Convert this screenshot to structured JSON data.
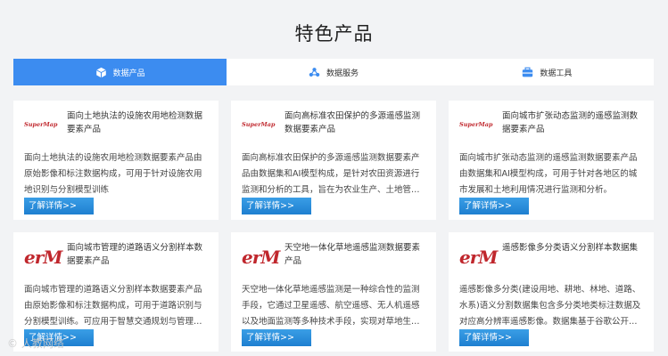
{
  "page_title": "特色产品",
  "tabs": [
    {
      "label": "数据产品",
      "icon": "cube-icon",
      "active": true
    },
    {
      "label": "数据服务",
      "icon": "network-icon",
      "active": false
    },
    {
      "label": "数据工具",
      "icon": "toolbox-icon",
      "active": false
    }
  ],
  "cards": [
    {
      "logo": "SuperMap",
      "title": "面向土地执法的设施农用地检测数据要素产品",
      "desc": "面向土地执法的设施农用地检测数据要素产品由原始影像和标注数据构成，可用于针对设施农用地识别与分割模型训练",
      "button": "了解详情>>"
    },
    {
      "logo": "SuperMap",
      "title": "面向高标准农田保护的多源遥感监测数据要素产品",
      "desc": "面向高标准农田保护的多源遥感监测数据要素产品由数据集和AI模型构成，是针对农田资源进行监测和分析的工具，旨在为农业生产、土地管…",
      "button": "了解详情>>"
    },
    {
      "logo": "SuperMap",
      "title": "面向城市扩张动态监测的遥感监测数据要素产品",
      "desc": "面向城市扩张动态监测的遥感监测数据要素产品由数据集和AI模型构成，可用于针对各地区的城市发展和土地利用情况进行监测和分析。",
      "button": "了解详情>>"
    },
    {
      "logo": "erM",
      "title": "面向城市管理的道路语义分割样本数据要素产品",
      "desc": "面向城市管理的道路语义分割样本数据要素产品由原始影像和标注数据构成，可用于道路识别与分割模型训练。可应用于智慧交通规划与管理…",
      "button": "了解详情>>"
    },
    {
      "logo": "erM",
      "title": "天空地一体化草地遥感监测数据要素产品",
      "desc": "天空地一体化草地遥感监测是一种综合性的监测手段，它通过卫星遥感、航空遥感、无人机遥感以及地面监测等多种技术手段，实现对草地生…",
      "button": "了解详情>>"
    },
    {
      "logo": "erM",
      "title": "遥感影像多分类语义分割样本数据集",
      "desc": "遥感影像多分类(建设用地、耕地、林地、道路、水系)语义分割数据集包含多分类地类标注数据及对应高分辨率遥感影像。数据集基于谷歌公开…",
      "button": "了解详情>>"
    }
  ],
  "watermark": "© 人教网络"
}
